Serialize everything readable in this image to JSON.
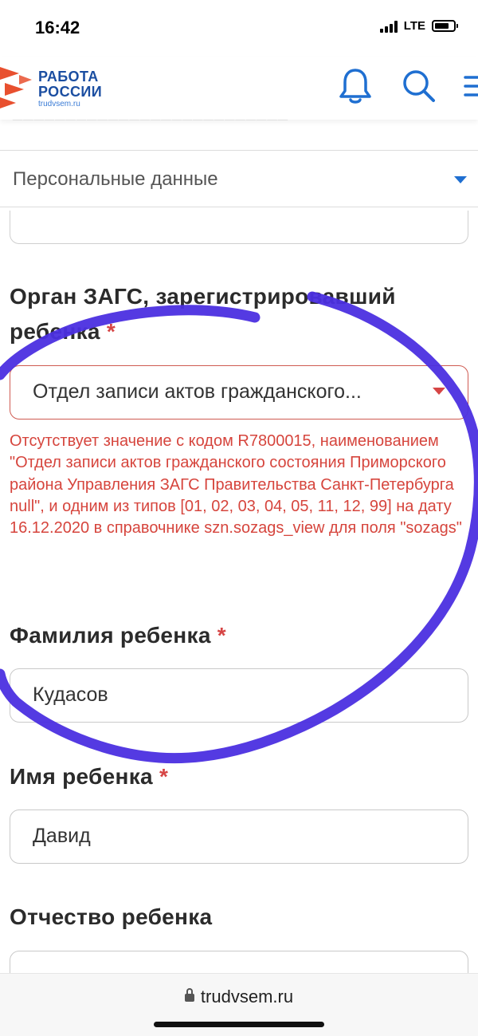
{
  "status_bar": {
    "time": "16:42",
    "network": "LTE"
  },
  "header": {
    "logo_line1": "РАБОТА",
    "logo_line2": "РОССИИ",
    "logo_domain": "trudvsem.ru"
  },
  "section_select": {
    "value": "Персональные данные"
  },
  "fields": {
    "zags": {
      "label_line1": "Орган ЗАГС, зарегистрировавший",
      "label_line2": "ребенка",
      "required": "*",
      "value": "Отдел записи актов гражданского...",
      "error": "Отсутствует значение с кодом R7800015, наименованием \"Отдел записи актов гражданского состояния Приморского района Управления ЗАГС Правительства Санкт-Петербурга null\", и одним из типов [01, 02, 03, 04, 05, 11, 12, 99] на дату 16.12.2020 в справочнике szn.sozags_view для поля \"sozags\""
    },
    "surname": {
      "label": "Фамилия ребенка",
      "required": "*",
      "value": "Кудасов"
    },
    "name": {
      "label": "Имя ребенка",
      "required": "*",
      "value": "Давид"
    },
    "patronymic": {
      "label": "Отчество ребенка"
    }
  },
  "browser": {
    "url": "trudvsem.ru"
  },
  "colors": {
    "brand_blue": "#1b4ea1",
    "error_red": "#d6453d",
    "annotation_purple": "#4b2fe0",
    "logo_orange": "#e8502f"
  }
}
